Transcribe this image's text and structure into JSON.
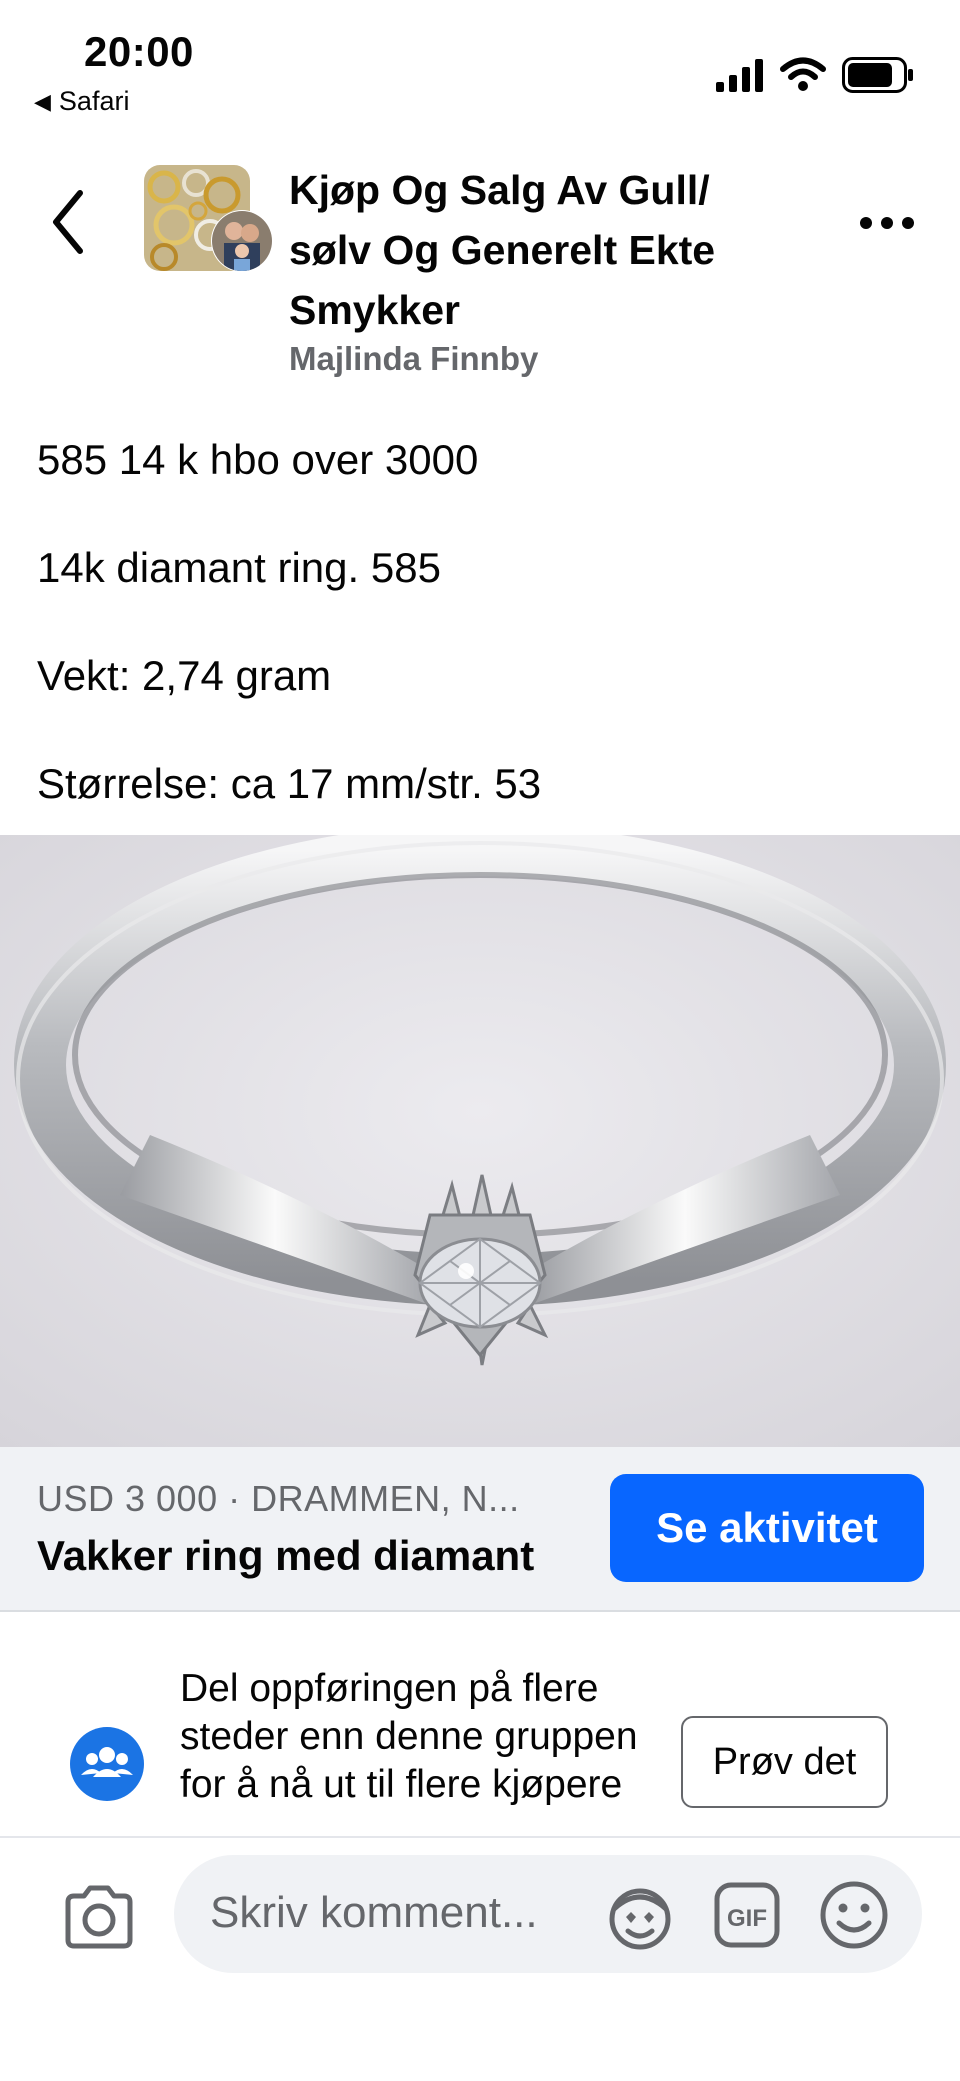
{
  "status_bar": {
    "time": "20:00",
    "back_app": "Safari"
  },
  "header": {
    "title_lines": [
      "Kjøp Og Salg Av Gull/",
      "sølv Og Generelt Ekte",
      "Smykker"
    ],
    "author": "Majlinda Finnby"
  },
  "post": {
    "lines": [
      "585 14 k hbo over 3000",
      "14k diamant ring. 585",
      "Vekt: 2,74 gram",
      "Størrelse: ca 17 mm/str. 53"
    ]
  },
  "listing": {
    "meta": "USD 3 000 · DRAMMEN, N...",
    "title": "Vakker ring med diamant",
    "button": "Se aktivitet"
  },
  "promo": {
    "text": "Del oppføringen på flere steder enn denne gruppen for å nå ut til flere kjøpere",
    "button": "Prøv det"
  },
  "comment": {
    "placeholder": "Skriv komment..."
  },
  "colors": {
    "accent": "#0866ff",
    "secondary_text": "#65676b",
    "bar_bg": "#f0f2f5"
  }
}
